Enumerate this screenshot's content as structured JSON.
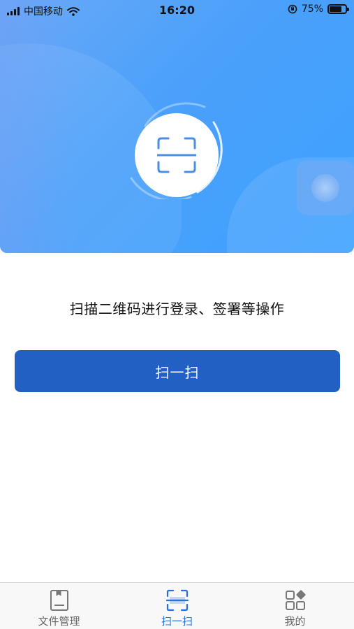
{
  "status_bar": {
    "carrier": "中国移动",
    "time": "16:20",
    "battery_percent": "75%",
    "battery_level": 0.75
  },
  "main": {
    "description": "扫描二维码进行登录、签署等操作",
    "scan_button_label": "扫一扫"
  },
  "tab_bar": {
    "tabs": [
      {
        "label": "文件管理",
        "icon": "document-icon",
        "active": false
      },
      {
        "label": "扫一扫",
        "icon": "scan-icon",
        "active": true
      },
      {
        "label": "我的",
        "icon": "apps-icon",
        "active": false
      }
    ]
  },
  "colors": {
    "primary": "#2260c4",
    "hero_blue": "#4aa0fa",
    "active_tab": "#2a6fd6",
    "inactive_tab": "#666666"
  }
}
